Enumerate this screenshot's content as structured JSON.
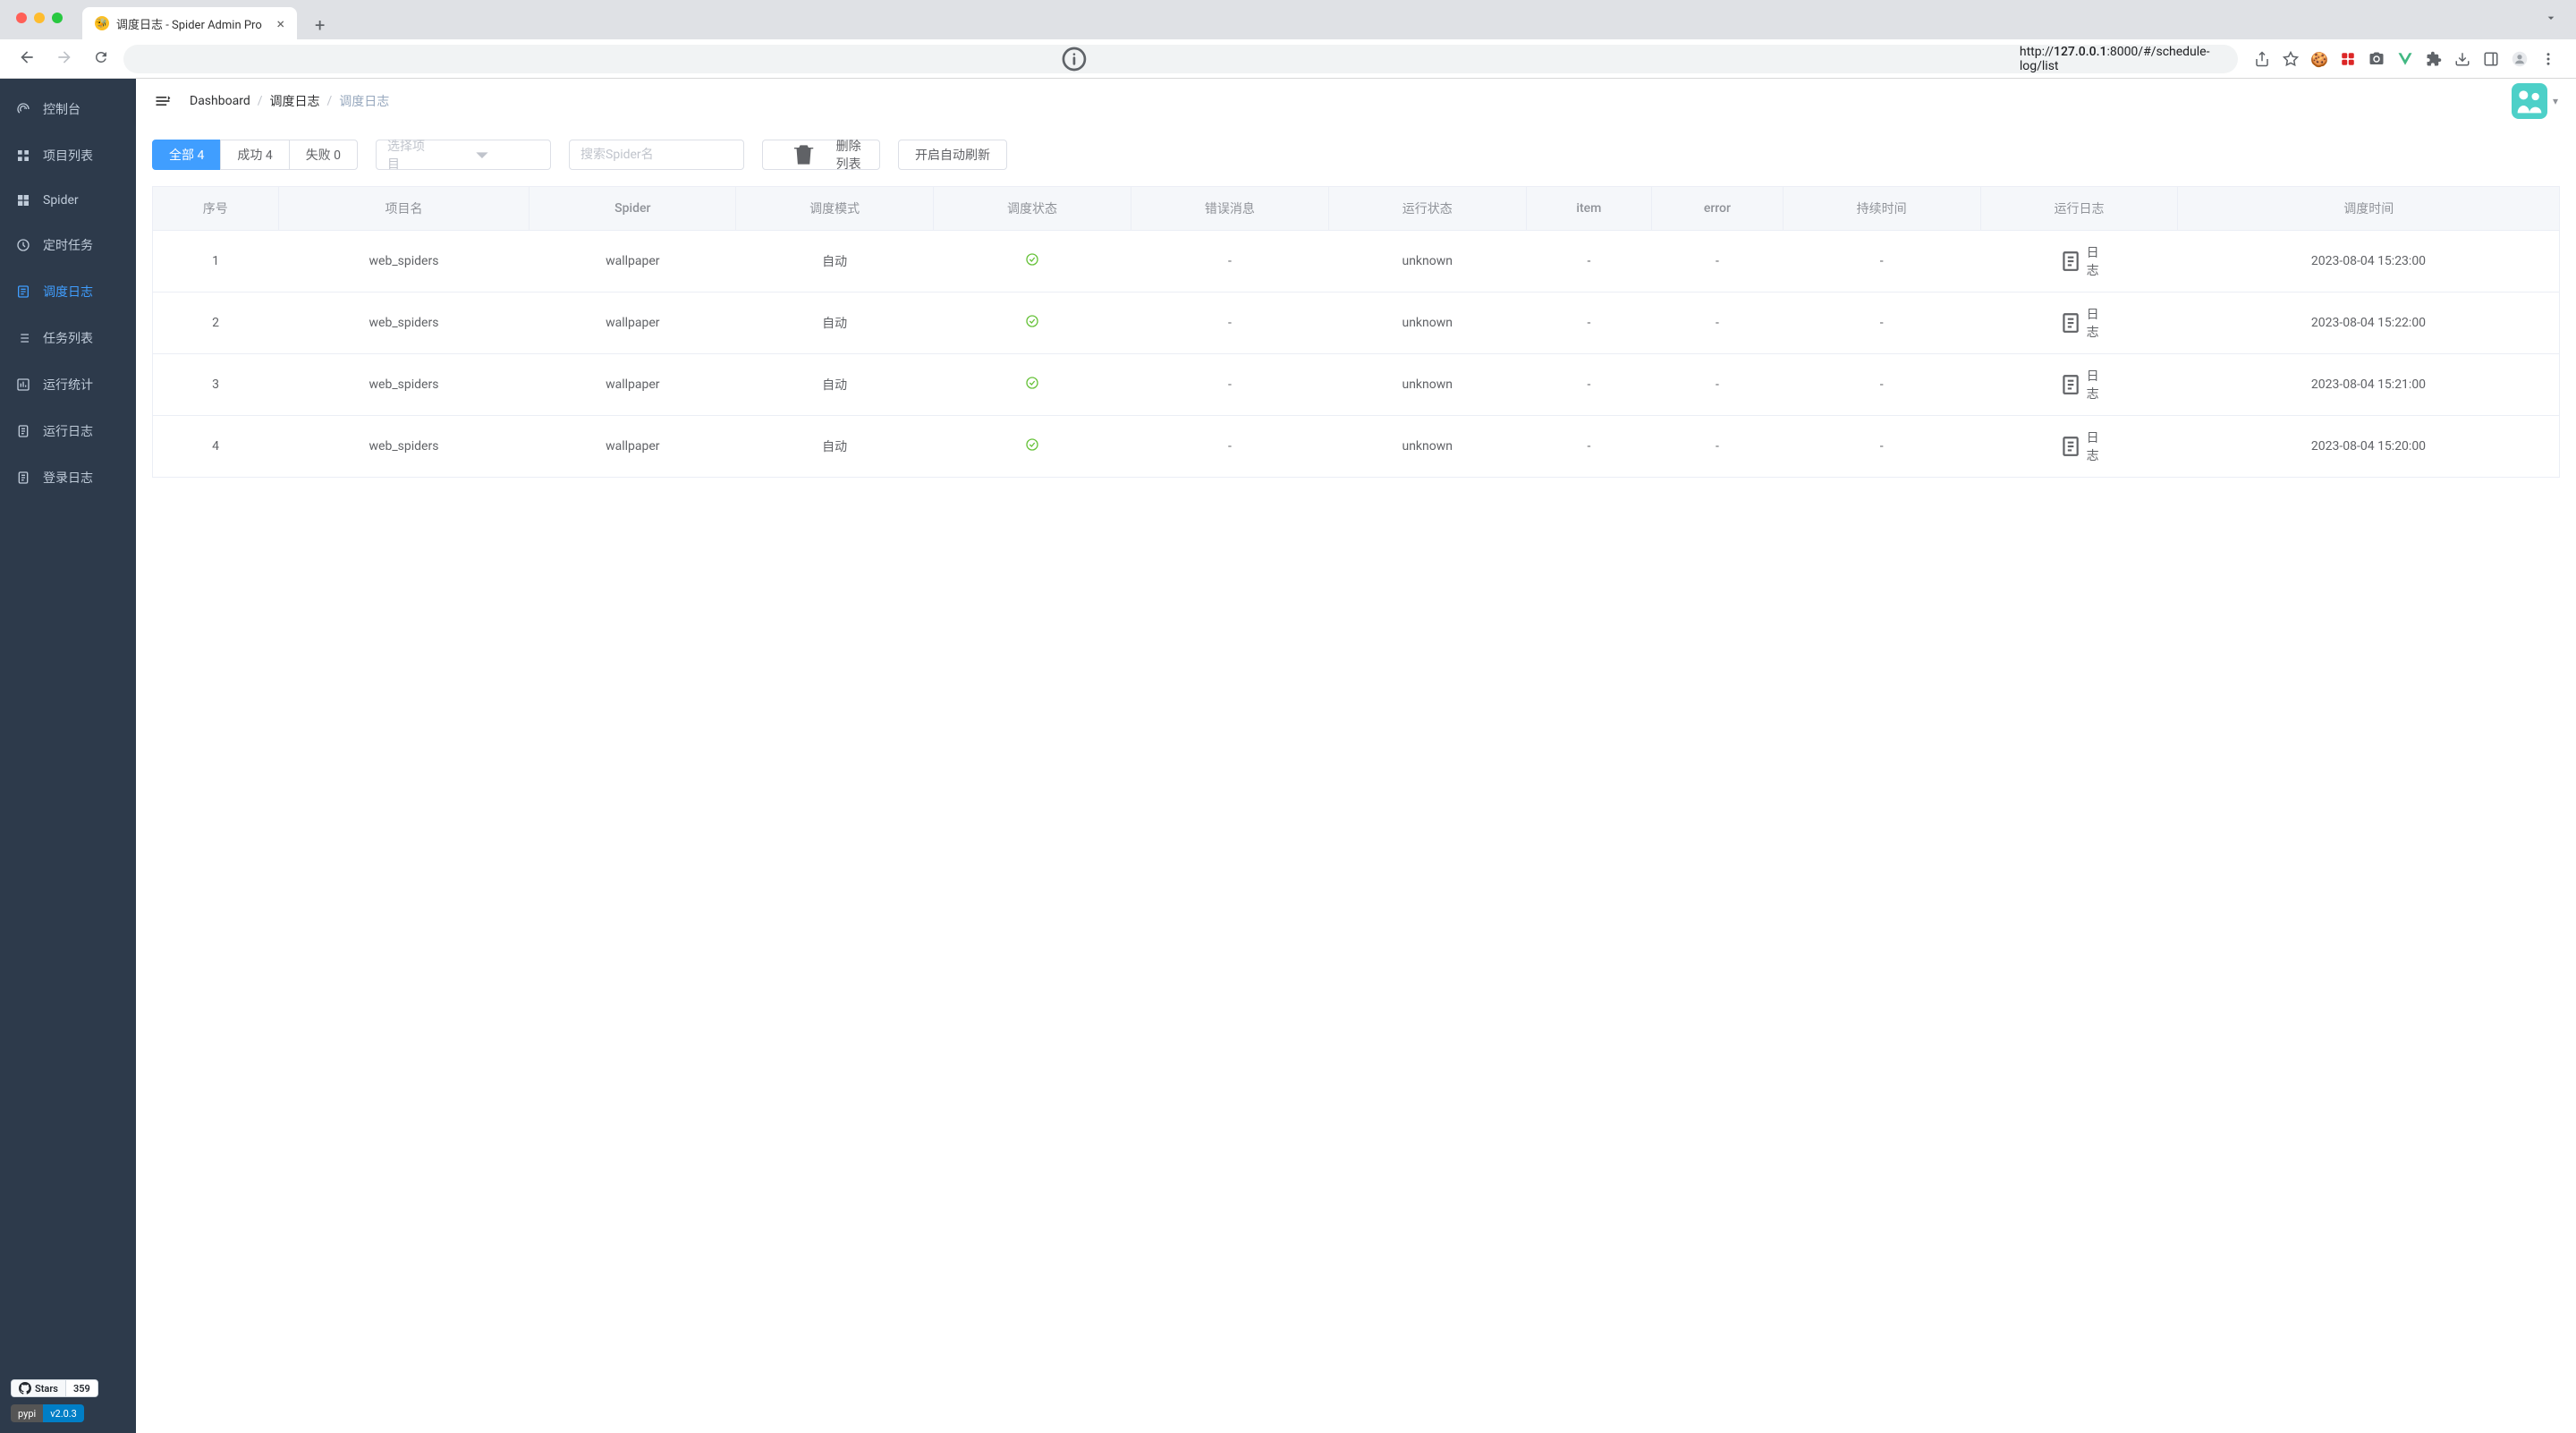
{
  "browser": {
    "tab_title": "调度日志 - Spider Admin Pro",
    "url_prefix": "http://",
    "url_host": "127.0.0.1",
    "url_path": ":8000/#/schedule-log/list"
  },
  "sidebar": {
    "items": [
      {
        "label": "控制台"
      },
      {
        "label": "项目列表"
      },
      {
        "label": "Spider"
      },
      {
        "label": "定时任务"
      },
      {
        "label": "调度日志"
      },
      {
        "label": "任务列表"
      },
      {
        "label": "运行统计"
      },
      {
        "label": "运行日志"
      },
      {
        "label": "登录日志"
      }
    ],
    "github": {
      "stars_label": "Stars",
      "stars_count": "359"
    },
    "pypi": {
      "label": "pypi",
      "version": "v2.0.3"
    }
  },
  "header": {
    "breadcrumbs": [
      {
        "label": "Dashboard"
      },
      {
        "label": "调度日志"
      },
      {
        "label": "调度日志"
      }
    ]
  },
  "filters": {
    "all": "全部 4",
    "success": "成功 4",
    "fail": "失败 0",
    "project_placeholder": "选择项目",
    "spider_placeholder": "搜索Spider名",
    "delete_list": "删除列表",
    "auto_refresh": "开启自动刷新"
  },
  "table": {
    "headers": [
      "序号",
      "项目名",
      "Spider",
      "调度模式",
      "调度状态",
      "错误消息",
      "运行状态",
      "item",
      "error",
      "持续时间",
      "运行日志",
      "调度时间"
    ],
    "log_link_label": "日志",
    "rows": [
      {
        "idx": "1",
        "project": "web_spiders",
        "spider": "wallpaper",
        "mode": "自动",
        "err_msg": "-",
        "run_status": "unknown",
        "item": "-",
        "error": "-",
        "duration": "-",
        "time": "2023-08-04 15:23:00"
      },
      {
        "idx": "2",
        "project": "web_spiders",
        "spider": "wallpaper",
        "mode": "自动",
        "err_msg": "-",
        "run_status": "unknown",
        "item": "-",
        "error": "-",
        "duration": "-",
        "time": "2023-08-04 15:22:00"
      },
      {
        "idx": "3",
        "project": "web_spiders",
        "spider": "wallpaper",
        "mode": "自动",
        "err_msg": "-",
        "run_status": "unknown",
        "item": "-",
        "error": "-",
        "duration": "-",
        "time": "2023-08-04 15:21:00"
      },
      {
        "idx": "4",
        "project": "web_spiders",
        "spider": "wallpaper",
        "mode": "自动",
        "err_msg": "-",
        "run_status": "unknown",
        "item": "-",
        "error": "-",
        "duration": "-",
        "time": "2023-08-04 15:20:00"
      }
    ]
  }
}
